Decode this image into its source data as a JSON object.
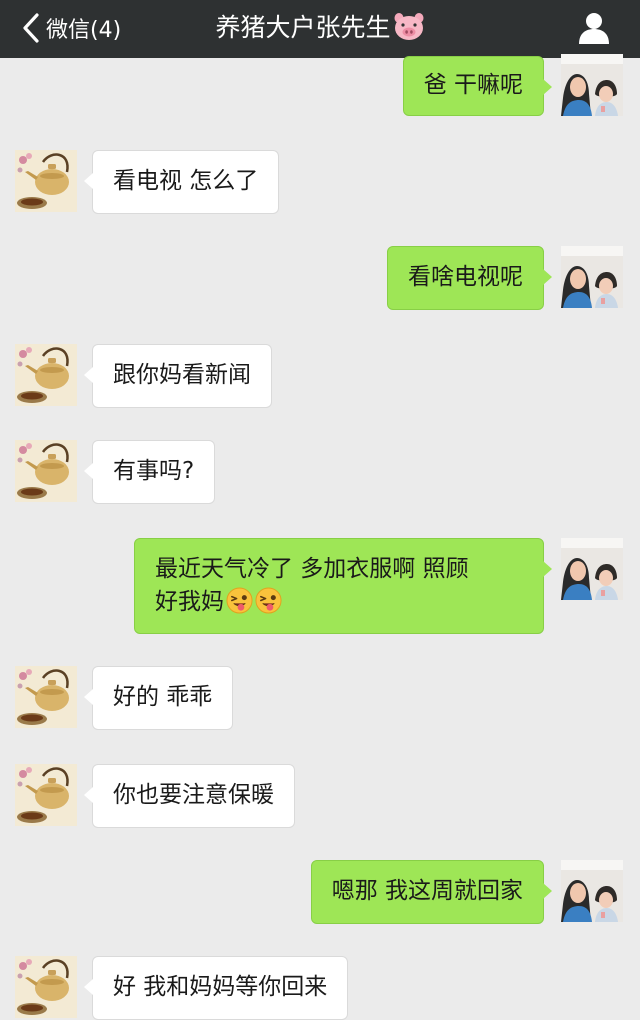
{
  "header": {
    "back_label": "微信(4)",
    "title": "养猪大户张先生",
    "title_emoji": "pig-face-icon",
    "profile_icon": "person-icon",
    "bg_color": "#2e3132"
  },
  "colors": {
    "background": "#ebebeb",
    "sent_bubble": "#9ee656",
    "received_bubble": "#ffffff"
  },
  "messages": [
    {
      "side": "right",
      "text": "爸 干嘛呢"
    },
    {
      "side": "left",
      "text": "看电视 怎么了"
    },
    {
      "side": "right",
      "text": "看啥电视呢"
    },
    {
      "side": "left",
      "text": "跟你妈看新闻"
    },
    {
      "side": "left",
      "text": "有事吗?"
    },
    {
      "side": "right",
      "text_line1": "最近天气冷了 多加衣服啊 照顾",
      "text_line2": "好我妈",
      "emojis": [
        "winking-tongue-face-icon",
        "winking-tongue-face-icon"
      ]
    },
    {
      "side": "left",
      "text": "好的 乖乖"
    },
    {
      "side": "left",
      "text": "你也要注意保暖"
    },
    {
      "side": "right",
      "text": "嗯那 我这周就回家"
    },
    {
      "side": "left",
      "text": "好 我和妈妈等你回来"
    }
  ]
}
